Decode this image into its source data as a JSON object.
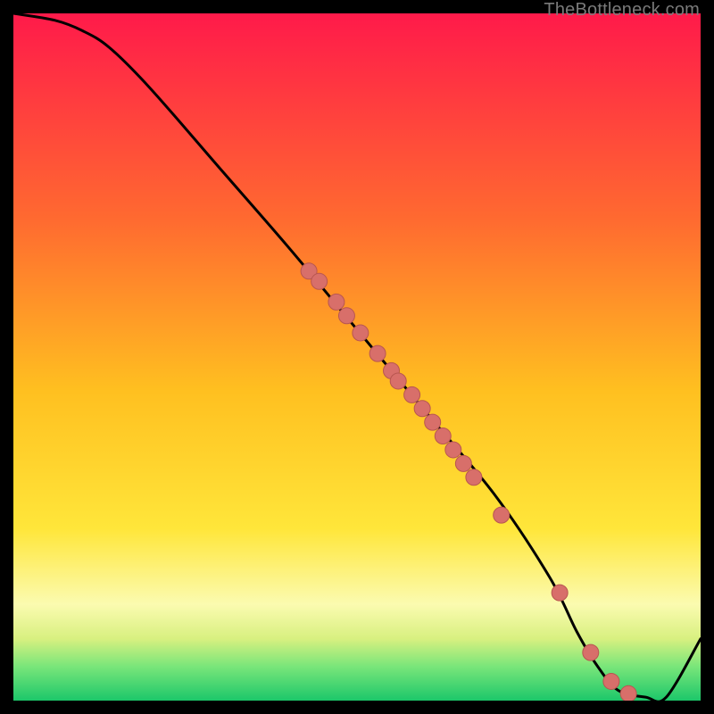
{
  "watermark": "TheBottleneck.com",
  "colors": {
    "red_top": "#ff1a4a",
    "orange": "#ff8a2a",
    "yellow": "#ffe63a",
    "pale_yellow": "#fcfca0",
    "green_light": "#7ae67a",
    "green": "#1cc76a",
    "curve": "#000000",
    "marker": "#d86f6a",
    "marker_stroke": "#b85650"
  },
  "chart_data": {
    "type": "line",
    "title": "",
    "xlabel": "",
    "ylabel": "",
    "xlim": [
      0,
      100
    ],
    "ylim": [
      0,
      100
    ],
    "curve": {
      "x": [
        0,
        6,
        10,
        14,
        20,
        30,
        40,
        50,
        60,
        70,
        78,
        82,
        85,
        88,
        92,
        95,
        100
      ],
      "y": [
        100,
        99,
        97.5,
        95,
        89,
        77.5,
        66,
        54,
        42,
        30,
        18,
        10,
        5,
        1.5,
        0.5,
        0.5,
        9
      ]
    },
    "markers": {
      "x": [
        43,
        44.5,
        47,
        48.5,
        50.5,
        53,
        55,
        56,
        58,
        59.5,
        61,
        62.5,
        64,
        65.5,
        67,
        71,
        79.5,
        84,
        87,
        89.5
      ],
      "y": [
        62.5,
        61,
        58,
        56,
        53.5,
        50.5,
        48,
        46.5,
        44.5,
        42.5,
        40.5,
        38.5,
        36.5,
        34.5,
        32.5,
        27,
        15.7,
        7,
        2.8,
        1.0
      ]
    }
  }
}
